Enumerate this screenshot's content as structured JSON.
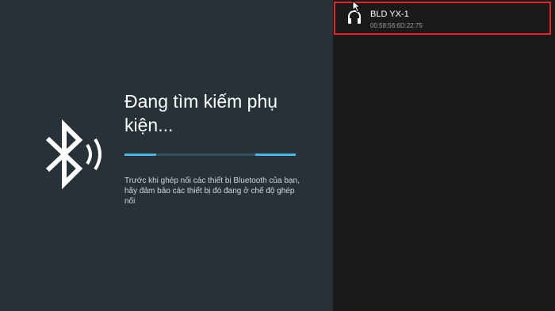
{
  "pairing": {
    "title": "Đang tìm kiếm phụ kiện...",
    "description": "Trước khi ghép nối các thiết bị Bluetooth của bạn, hãy đảm bảo các thiết bị đó đang ở chế độ ghép nối",
    "icon": "bluetooth-searching-icon",
    "progress_state": "indeterminate"
  },
  "devices": [
    {
      "name": "BLD YX-1",
      "address": "00:58:56:6D:22:75",
      "icon": "headset-icon",
      "highlighted": true
    }
  ],
  "colors": {
    "left_bg": "#263238",
    "right_bg": "#1a1a1a",
    "accent": "#4fb3e8",
    "highlight_border": "#e3242b"
  }
}
